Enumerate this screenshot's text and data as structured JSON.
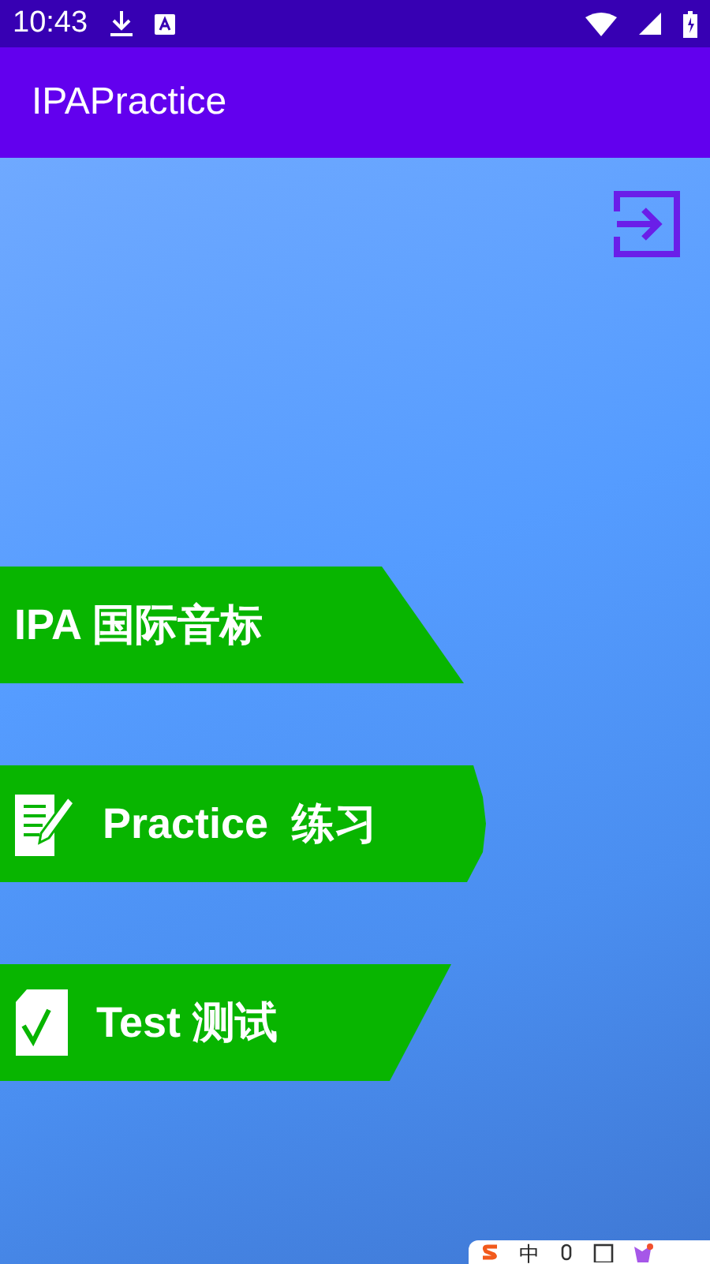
{
  "status_bar": {
    "time": "10:43"
  },
  "app_bar": {
    "title": "IPAPractice"
  },
  "menu": [
    {
      "kind": "plain",
      "label": "IPA 国际音标"
    },
    {
      "kind": "practice",
      "label": "Practice  练习"
    },
    {
      "kind": "test",
      "label": "Test 测试"
    }
  ],
  "ime_bar": {
    "language": "中"
  }
}
